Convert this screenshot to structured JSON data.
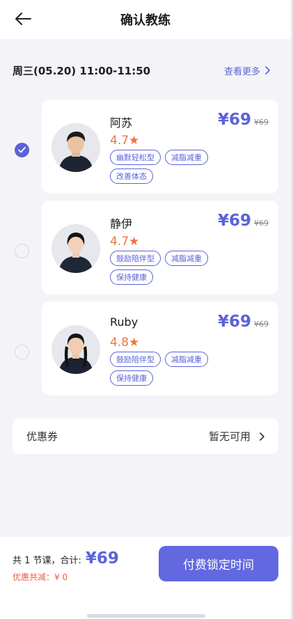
{
  "header": {
    "title": "确认教练",
    "back_icon": "arrow-left-icon"
  },
  "slot": {
    "time": "周三(05.20) 11:00-11:50",
    "view_more": "查看更多"
  },
  "coaches": [
    {
      "name": "阿苏",
      "rating": "4.7★",
      "price": "¥69",
      "original_price": "¥69",
      "tags": [
        "幽默轻松型",
        "减脂减重",
        "改善体态"
      ],
      "selected": true
    },
    {
      "name": "静伊",
      "rating": "4.7★",
      "price": "¥69",
      "original_price": "¥69",
      "tags": [
        "鼓励陪伴型",
        "减脂减重",
        "保持健康"
      ],
      "selected": false
    },
    {
      "name": "Ruby",
      "rating": "4.8★",
      "price": "¥69",
      "original_price": "¥69",
      "tags": [
        "鼓励陪伴型",
        "减脂减重",
        "保持健康"
      ],
      "selected": false
    }
  ],
  "coupon": {
    "label": "优惠券",
    "value": "暂无可用"
  },
  "footer": {
    "summary": "共 1 节课，合计:",
    "total": "¥69",
    "discount": "优惠共减：¥ 0",
    "pay_button": "付费锁定时间"
  },
  "colors": {
    "accent": "#5a63d8",
    "button": "#6268e0",
    "rating": "#f07442",
    "discount": "#ef5a3c",
    "background": "#f4f4f8"
  }
}
